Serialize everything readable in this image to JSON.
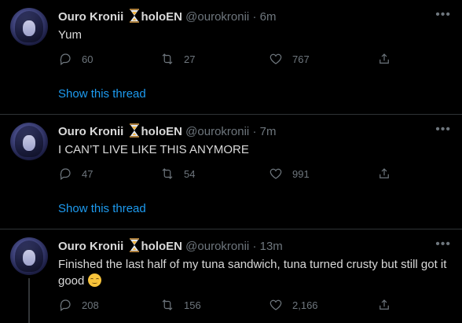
{
  "tweets": [
    {
      "author": "Ouro Kronii",
      "org": "holoEN",
      "handle": "@ourokronii",
      "time": "6m",
      "text": "Yum",
      "replies": "60",
      "retweets": "27",
      "likes": "767",
      "show_thread": "Show this thread"
    },
    {
      "author": "Ouro Kronii",
      "org": "holoEN",
      "handle": "@ourokronii",
      "time": "7m",
      "text": "I CAN’T LIVE LIKE THIS ANYMORE",
      "replies": "47",
      "retweets": "54",
      "likes": "991",
      "show_thread": "Show this thread"
    },
    {
      "author": "Ouro Kronii",
      "org": "holoEN",
      "handle": "@ourokronii",
      "time": "13m",
      "text_line1": "Finished the last half of my tuna sandwich, tuna turned crusty but still got it",
      "text_line2": "good",
      "replies": "208",
      "retweets": "156",
      "likes": "2,166"
    }
  ],
  "separator_dot": "·",
  "icons": {
    "reply": "reply-icon",
    "retweet": "retweet-icon",
    "like": "heart-icon",
    "share": "share-icon",
    "more": "more-icon",
    "hourglass": "hourglass-emoji",
    "emoji": "relieved-face-emoji"
  },
  "colors": {
    "link": "#1d9bf0",
    "muted": "#6e767d",
    "bg": "#000000"
  }
}
